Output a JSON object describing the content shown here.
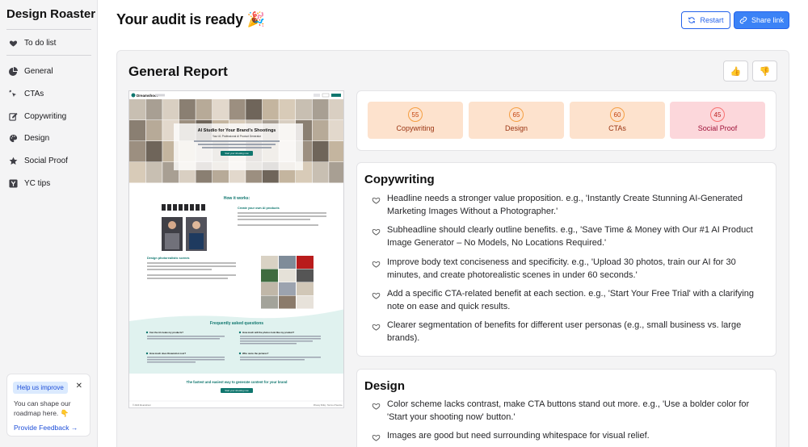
{
  "sidebar": {
    "brand": "Design Roaster",
    "todo": "To do list",
    "items": [
      {
        "label": "General",
        "icon": "pie-chart-icon"
      },
      {
        "label": "CTAs",
        "icon": "click-icon"
      },
      {
        "label": "Copywriting",
        "icon": "pencil-icon"
      },
      {
        "label": "Design",
        "icon": "palette-icon"
      },
      {
        "label": "Social Proof",
        "icon": "star-icon"
      },
      {
        "label": "YC tips",
        "icon": "yc-icon"
      }
    ],
    "help": {
      "badge": "Help us improve",
      "text": "You can shape our roadmap here. 👇",
      "link": "Provide Feedback →"
    }
  },
  "header": {
    "title": "Your audit is ready 🎉",
    "restart": "Restart",
    "share": "Share link"
  },
  "report": {
    "title": "General Report",
    "thumbs_up": "👍",
    "thumbs_down": "👎"
  },
  "scores": [
    {
      "value": "55",
      "label": "Copywriting",
      "tone": "orange"
    },
    {
      "value": "65",
      "label": "Design",
      "tone": "orange"
    },
    {
      "value": "60",
      "label": "CTAs",
      "tone": "orange"
    },
    {
      "value": "45",
      "label": "Social Proof",
      "tone": "red"
    }
  ],
  "copywriting": {
    "title": "Copywriting",
    "items": [
      "Headline needs a stronger value proposition. e.g., 'Instantly Create Stunning AI-Generated Marketing Images Without a Photographer.'",
      "Subheadline should clearly outline benefits. e.g., 'Save Time & Money with Our #1 AI Product Image Generator – No Models, No Locations Required.'",
      "Improve body text conciseness and specificity. e.g., 'Upload 30 photos, train our AI for 30 minutes, and create photorealistic scenes in under 60 seconds.'",
      "Add a specific CTA-related benefit at each section. e.g., 'Start Your Free Trial' with a clarifying note on ease and quick results.",
      "Clearer segmentation of benefits for different user personas (e.g., small business vs. large brands)."
    ]
  },
  "design": {
    "title": "Design",
    "items": [
      "Color scheme lacks contrast, make CTA buttons stand out more. e.g., 'Use a bolder color for 'Start your shooting now' button.'",
      "Images are good but need surrounding whitespace for visual relief."
    ]
  },
  "preview": {
    "logo": "Dreamshoot",
    "hero_title": "AI Studio for Your Brand's Shootings",
    "hero_sub": "Your #1 Professional AI Product Generator",
    "hero_cta": "Start your shooting now",
    "how_title": "How it works:",
    "step1_title": "Create your own AI products",
    "step2_title": "Design photorealistic scenes",
    "faq_title": "Frequently asked questions",
    "faq_q1": "Can the AI create my products?",
    "faq_q2": "How much will the photos look like my product?",
    "faq_q3": "How much does Dreamshot cost?",
    "faq_q4": "Who owns the pictures?",
    "footer_title": "The fastest and easiest way to generate content for your brand",
    "footer_cta": "Start your shooting now",
    "copyright": "© 2024 Dreamshoot",
    "policy": "Privacy Policy",
    "terms": "Terms of Service",
    "accent": "#0f766e"
  }
}
